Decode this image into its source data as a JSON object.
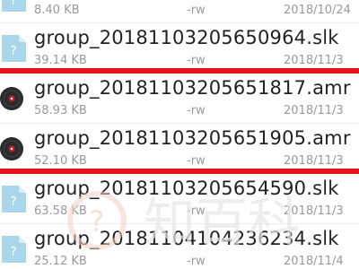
{
  "files": [
    {
      "name": "",
      "size": "8.40 KB",
      "perm": "-rw",
      "date": "2018/10/24",
      "icon": "document-file-icon"
    },
    {
      "name": "group_20181103205650964.slk",
      "size": "39.14 KB",
      "perm": "-rw",
      "date": "2018/11/3",
      "icon": "document-file-icon"
    },
    {
      "name": "group_20181103205651817.amr",
      "size": "58.93 KB",
      "perm": "-rw",
      "date": "2018/11/3",
      "icon": "audio-disc-icon"
    },
    {
      "name": "group_20181103205651905.amr",
      "size": "52.10 KB",
      "perm": "-rw",
      "date": "2018/11/3",
      "icon": "audio-disc-icon"
    },
    {
      "name": "group_20181103205654590.slk",
      "size": "63.58 KB",
      "perm": "-rw",
      "date": "2018/11/3",
      "icon": "document-file-icon"
    },
    {
      "name": "group_20181104104236234.slk",
      "size": "25.12 KB",
      "perm": "-rw",
      "date": "2018/11/4",
      "icon": "document-file-icon"
    }
  ],
  "highlight_color": "#e8141c",
  "file_icon_color": "#a9d7ea",
  "audio_icon_color": "#2b2b2b",
  "watermark_text": "知百科"
}
